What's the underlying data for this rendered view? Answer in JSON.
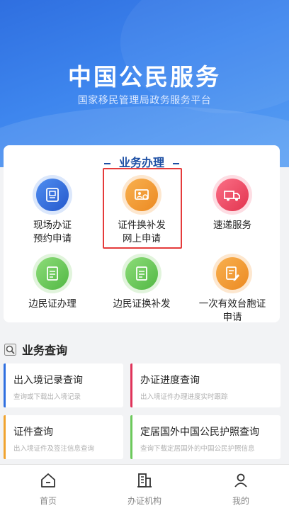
{
  "header": {
    "title": "中国公民服务",
    "subtitle": "国家移民管理局政务服务平台"
  },
  "business": {
    "title": "业务办理",
    "items": [
      {
        "label_lines": [
          "现场办证",
          "预约申请"
        ],
        "icon": "id-card-icon",
        "color": "#2f6fe0"
      },
      {
        "label_lines": [
          "证件换补发",
          "网上申请"
        ],
        "icon": "photo-id-icon",
        "color": "#f0922f"
      },
      {
        "label_lines": [
          "速递服务",
          ""
        ],
        "icon": "delivery-truck-icon",
        "color": "#ee4a64"
      },
      {
        "label_lines": [
          "边民证办理",
          ""
        ],
        "icon": "document-icon",
        "color": "#6cc95b"
      },
      {
        "label_lines": [
          "边民证换补发",
          ""
        ],
        "icon": "document-icon",
        "color": "#6cc95b"
      },
      {
        "label_lines": [
          "一次有效台胞证",
          "申请"
        ],
        "icon": "edit-document-icon",
        "color": "#f0922f"
      }
    ]
  },
  "query": {
    "title": "业务查询",
    "items": [
      {
        "title": "出入境记录查询",
        "sub": "查询或下载出入境记录",
        "color": "#2f6fe0"
      },
      {
        "title": "办证进度查询",
        "sub": "出入境证件办理进度实时跟踪",
        "color": "#e0335a"
      },
      {
        "title": "证件查询",
        "sub": "出入境证件及签注信息查询",
        "color": "#f0a32f"
      },
      {
        "title": "定居国外中国公民护照查询",
        "sub": "查询下载定居国外的中国公民护照信息",
        "color": "#6cc95b"
      }
    ]
  },
  "tabs": [
    {
      "label": "首页",
      "icon": "home-icon"
    },
    {
      "label": "办证机构",
      "icon": "building-icon"
    },
    {
      "label": "我的",
      "icon": "user-icon"
    }
  ],
  "colors": {
    "accent": "#2f6fe0",
    "highlight": "#e53b3b",
    "title_blue": "#1d4fa4"
  }
}
